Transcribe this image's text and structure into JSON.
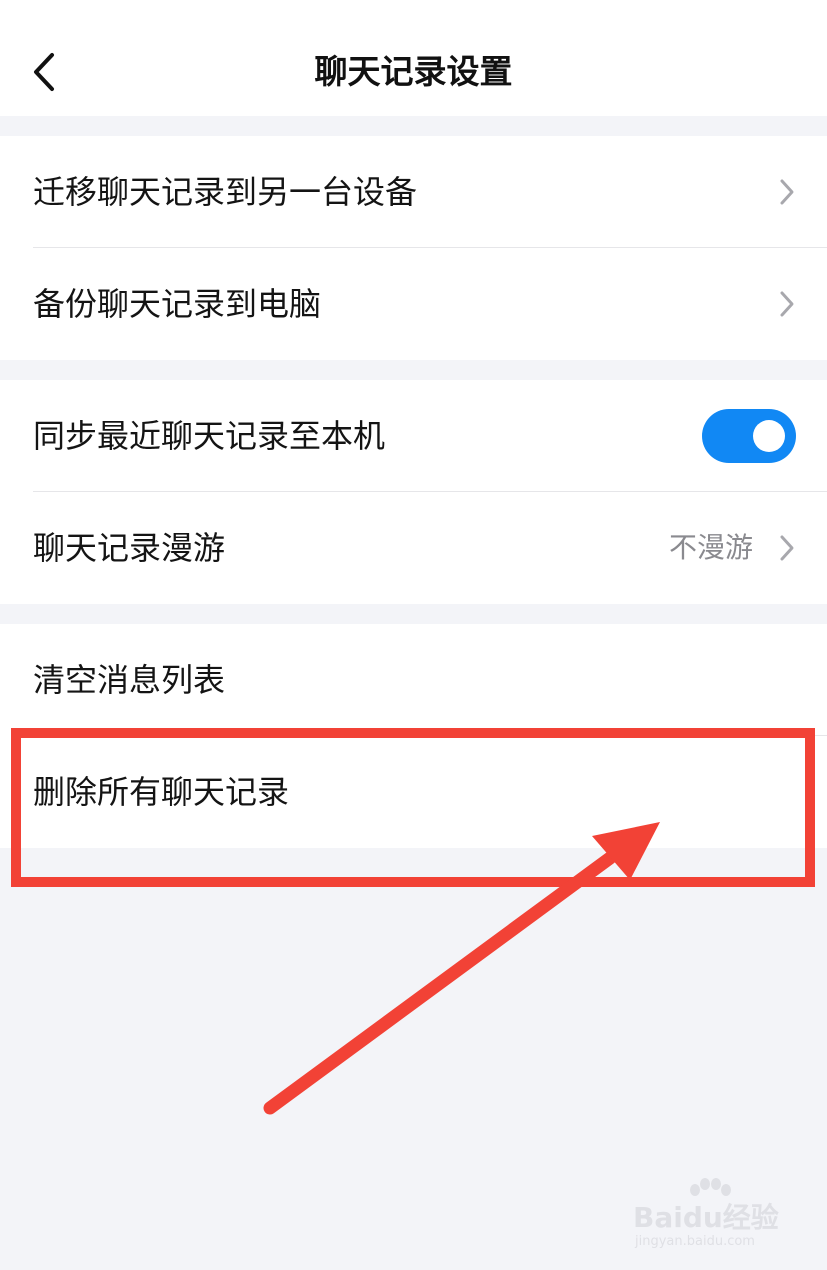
{
  "header": {
    "title": "聊天记录设置",
    "back_icon": "chevron-left-icon"
  },
  "groups": [
    {
      "items": [
        {
          "label": "迁移聊天记录到另一台设备",
          "accessory": "chevron"
        },
        {
          "label": "备份聊天记录到电脑",
          "accessory": "chevron"
        }
      ]
    },
    {
      "items": [
        {
          "label": "同步最近聊天记录至本机",
          "accessory": "toggle",
          "toggle_on": true
        },
        {
          "label": "聊天记录漫游",
          "value": "不漫游",
          "accessory": "chevron"
        }
      ]
    },
    {
      "items": [
        {
          "label": "清空消息列表",
          "accessory": "none"
        },
        {
          "label": "删除所有聊天记录",
          "accessory": "none"
        }
      ]
    }
  ],
  "annotation": {
    "highlight_color": "#f24236",
    "target": "删除所有聊天记录"
  },
  "watermark": {
    "main": "Baidu经验",
    "sub": "jingyan.baidu.com"
  },
  "colors": {
    "toggle_on": "#1188f4",
    "background": "#f3f4f8",
    "secondary_text": "#8a8a8f"
  }
}
